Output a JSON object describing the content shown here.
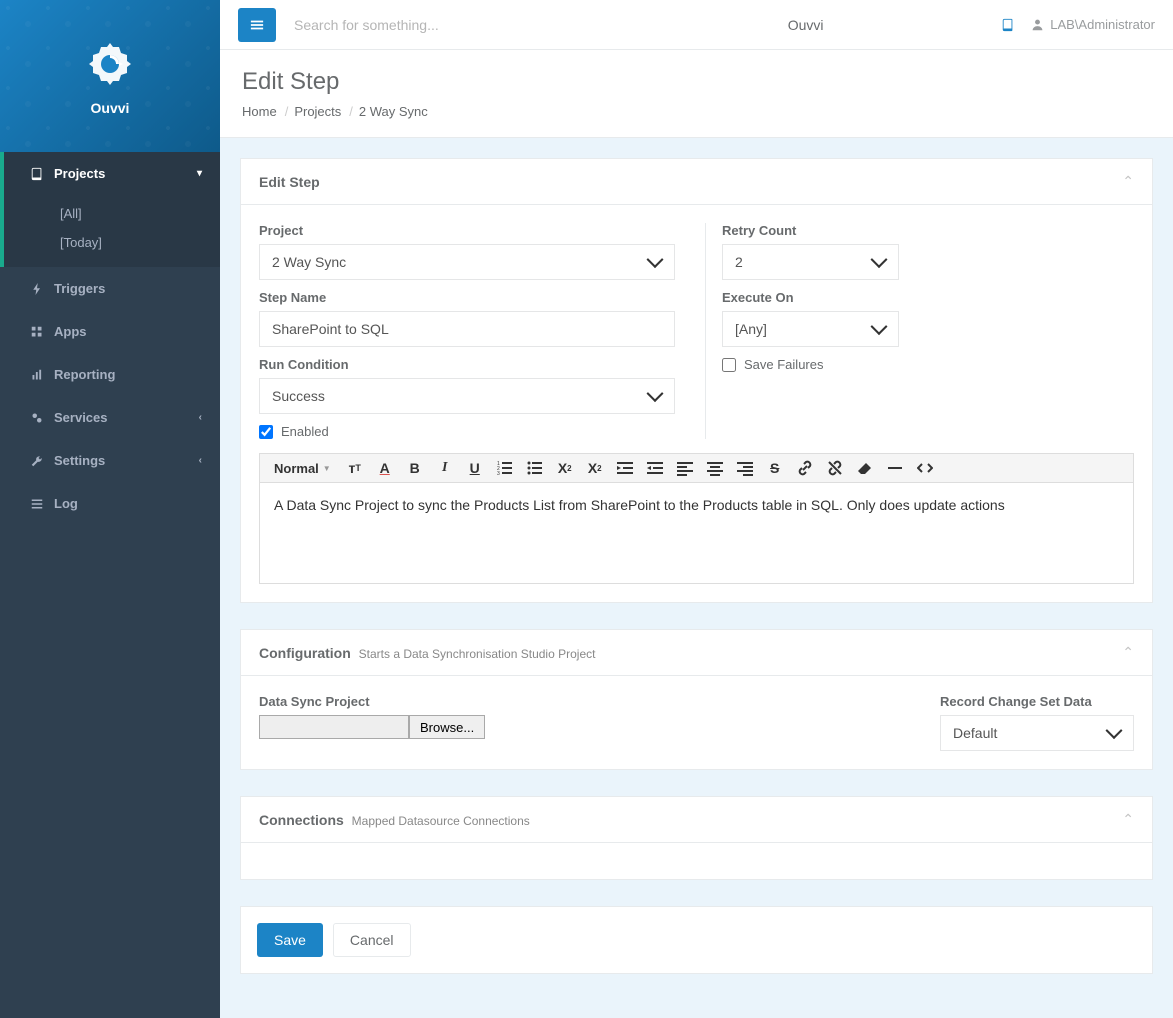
{
  "app": {
    "product": "Ouvvi",
    "topbar_title": "Ouvvi"
  },
  "topbar": {
    "search_placeholder": "Search for something...",
    "user": "LAB\\Administrator"
  },
  "sidebar": {
    "items": [
      {
        "label": "Projects",
        "icon": "book-icon",
        "expandable": true,
        "open": true,
        "subitems": [
          "[All]",
          "[Today]"
        ]
      },
      {
        "label": "Triggers",
        "icon": "bolt-icon"
      },
      {
        "label": "Apps",
        "icon": "grid-icon"
      },
      {
        "label": "Reporting",
        "icon": "chart-icon"
      },
      {
        "label": "Services",
        "icon": "cogs-icon",
        "expandable": true
      },
      {
        "label": "Settings",
        "icon": "wrench-icon",
        "expandable": true
      },
      {
        "label": "Log",
        "icon": "list-icon"
      }
    ]
  },
  "page": {
    "title": "Edit Step",
    "breadcrumb": [
      "Home",
      "Projects",
      "2 Way Sync"
    ]
  },
  "panels": {
    "edit_step": {
      "title": "Edit Step",
      "project_label": "Project",
      "project_value": "2 Way Sync",
      "stepname_label": "Step Name",
      "stepname_value": "SharePoint to SQL",
      "runcond_label": "Run Condition",
      "runcond_value": "Success",
      "enabled_label": "Enabled",
      "enabled_checked": true,
      "retry_label": "Retry Count",
      "retry_value": "2",
      "exec_label": "Execute On",
      "exec_value": "[Any]",
      "savefail_label": "Save Failures",
      "savefail_checked": false,
      "editor_format": "Normal",
      "editor_text": "A Data Sync Project to sync the Products List from SharePoint to the Products table in SQL. Only does update actions"
    },
    "configuration": {
      "title": "Configuration",
      "subtitle": "Starts a Data Synchronisation Studio Project",
      "ds_label": "Data Sync Project",
      "browse_label": "Browse...",
      "record_label": "Record Change Set Data",
      "record_value": "Default"
    },
    "connections": {
      "title": "Connections",
      "subtitle": "Mapped Datasource Connections"
    }
  },
  "actions": {
    "save": "Save",
    "cancel": "Cancel"
  }
}
